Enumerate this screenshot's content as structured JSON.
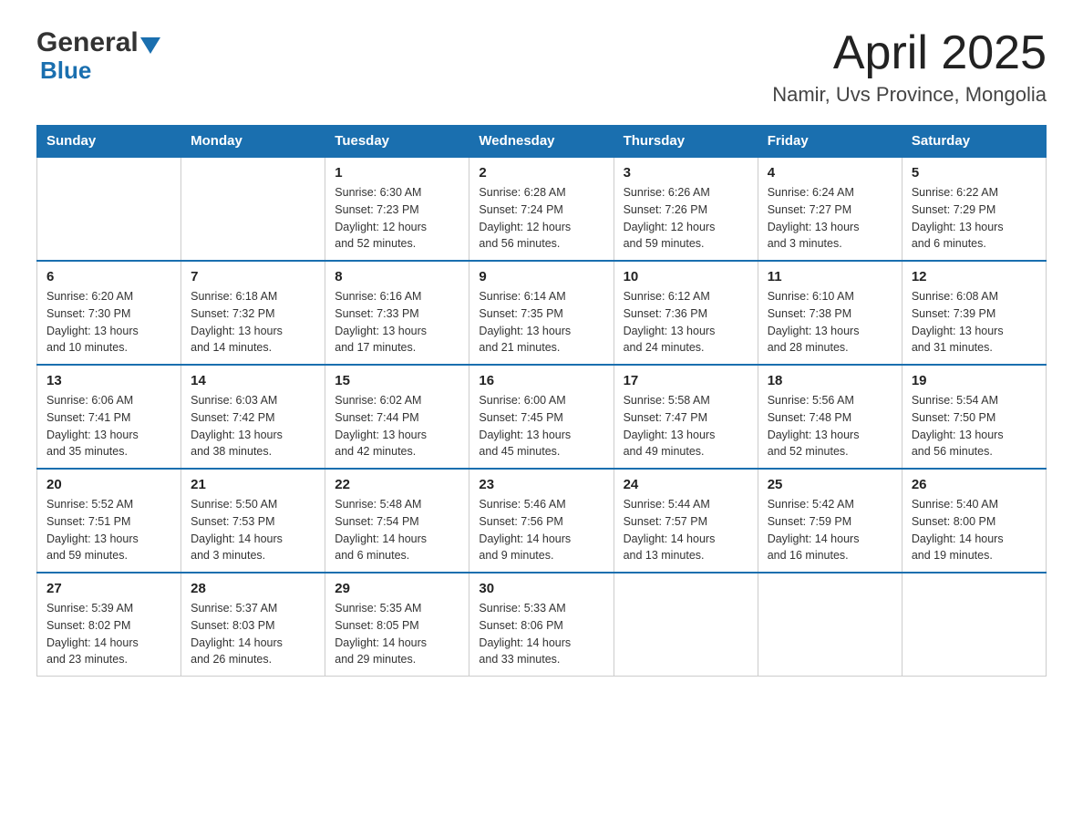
{
  "header": {
    "logo_general": "General",
    "logo_blue": "Blue",
    "month_title": "April 2025",
    "location": "Namir, Uvs Province, Mongolia"
  },
  "days_of_week": [
    "Sunday",
    "Monday",
    "Tuesday",
    "Wednesday",
    "Thursday",
    "Friday",
    "Saturday"
  ],
  "weeks": [
    [
      {
        "day": "",
        "info": ""
      },
      {
        "day": "",
        "info": ""
      },
      {
        "day": "1",
        "info": "Sunrise: 6:30 AM\nSunset: 7:23 PM\nDaylight: 12 hours\nand 52 minutes."
      },
      {
        "day": "2",
        "info": "Sunrise: 6:28 AM\nSunset: 7:24 PM\nDaylight: 12 hours\nand 56 minutes."
      },
      {
        "day": "3",
        "info": "Sunrise: 6:26 AM\nSunset: 7:26 PM\nDaylight: 12 hours\nand 59 minutes."
      },
      {
        "day": "4",
        "info": "Sunrise: 6:24 AM\nSunset: 7:27 PM\nDaylight: 13 hours\nand 3 minutes."
      },
      {
        "day": "5",
        "info": "Sunrise: 6:22 AM\nSunset: 7:29 PM\nDaylight: 13 hours\nand 6 minutes."
      }
    ],
    [
      {
        "day": "6",
        "info": "Sunrise: 6:20 AM\nSunset: 7:30 PM\nDaylight: 13 hours\nand 10 minutes."
      },
      {
        "day": "7",
        "info": "Sunrise: 6:18 AM\nSunset: 7:32 PM\nDaylight: 13 hours\nand 14 minutes."
      },
      {
        "day": "8",
        "info": "Sunrise: 6:16 AM\nSunset: 7:33 PM\nDaylight: 13 hours\nand 17 minutes."
      },
      {
        "day": "9",
        "info": "Sunrise: 6:14 AM\nSunset: 7:35 PM\nDaylight: 13 hours\nand 21 minutes."
      },
      {
        "day": "10",
        "info": "Sunrise: 6:12 AM\nSunset: 7:36 PM\nDaylight: 13 hours\nand 24 minutes."
      },
      {
        "day": "11",
        "info": "Sunrise: 6:10 AM\nSunset: 7:38 PM\nDaylight: 13 hours\nand 28 minutes."
      },
      {
        "day": "12",
        "info": "Sunrise: 6:08 AM\nSunset: 7:39 PM\nDaylight: 13 hours\nand 31 minutes."
      }
    ],
    [
      {
        "day": "13",
        "info": "Sunrise: 6:06 AM\nSunset: 7:41 PM\nDaylight: 13 hours\nand 35 minutes."
      },
      {
        "day": "14",
        "info": "Sunrise: 6:03 AM\nSunset: 7:42 PM\nDaylight: 13 hours\nand 38 minutes."
      },
      {
        "day": "15",
        "info": "Sunrise: 6:02 AM\nSunset: 7:44 PM\nDaylight: 13 hours\nand 42 minutes."
      },
      {
        "day": "16",
        "info": "Sunrise: 6:00 AM\nSunset: 7:45 PM\nDaylight: 13 hours\nand 45 minutes."
      },
      {
        "day": "17",
        "info": "Sunrise: 5:58 AM\nSunset: 7:47 PM\nDaylight: 13 hours\nand 49 minutes."
      },
      {
        "day": "18",
        "info": "Sunrise: 5:56 AM\nSunset: 7:48 PM\nDaylight: 13 hours\nand 52 minutes."
      },
      {
        "day": "19",
        "info": "Sunrise: 5:54 AM\nSunset: 7:50 PM\nDaylight: 13 hours\nand 56 minutes."
      }
    ],
    [
      {
        "day": "20",
        "info": "Sunrise: 5:52 AM\nSunset: 7:51 PM\nDaylight: 13 hours\nand 59 minutes."
      },
      {
        "day": "21",
        "info": "Sunrise: 5:50 AM\nSunset: 7:53 PM\nDaylight: 14 hours\nand 3 minutes."
      },
      {
        "day": "22",
        "info": "Sunrise: 5:48 AM\nSunset: 7:54 PM\nDaylight: 14 hours\nand 6 minutes."
      },
      {
        "day": "23",
        "info": "Sunrise: 5:46 AM\nSunset: 7:56 PM\nDaylight: 14 hours\nand 9 minutes."
      },
      {
        "day": "24",
        "info": "Sunrise: 5:44 AM\nSunset: 7:57 PM\nDaylight: 14 hours\nand 13 minutes."
      },
      {
        "day": "25",
        "info": "Sunrise: 5:42 AM\nSunset: 7:59 PM\nDaylight: 14 hours\nand 16 minutes."
      },
      {
        "day": "26",
        "info": "Sunrise: 5:40 AM\nSunset: 8:00 PM\nDaylight: 14 hours\nand 19 minutes."
      }
    ],
    [
      {
        "day": "27",
        "info": "Sunrise: 5:39 AM\nSunset: 8:02 PM\nDaylight: 14 hours\nand 23 minutes."
      },
      {
        "day": "28",
        "info": "Sunrise: 5:37 AM\nSunset: 8:03 PM\nDaylight: 14 hours\nand 26 minutes."
      },
      {
        "day": "29",
        "info": "Sunrise: 5:35 AM\nSunset: 8:05 PM\nDaylight: 14 hours\nand 29 minutes."
      },
      {
        "day": "30",
        "info": "Sunrise: 5:33 AM\nSunset: 8:06 PM\nDaylight: 14 hours\nand 33 minutes."
      },
      {
        "day": "",
        "info": ""
      },
      {
        "day": "",
        "info": ""
      },
      {
        "day": "",
        "info": ""
      }
    ]
  ]
}
